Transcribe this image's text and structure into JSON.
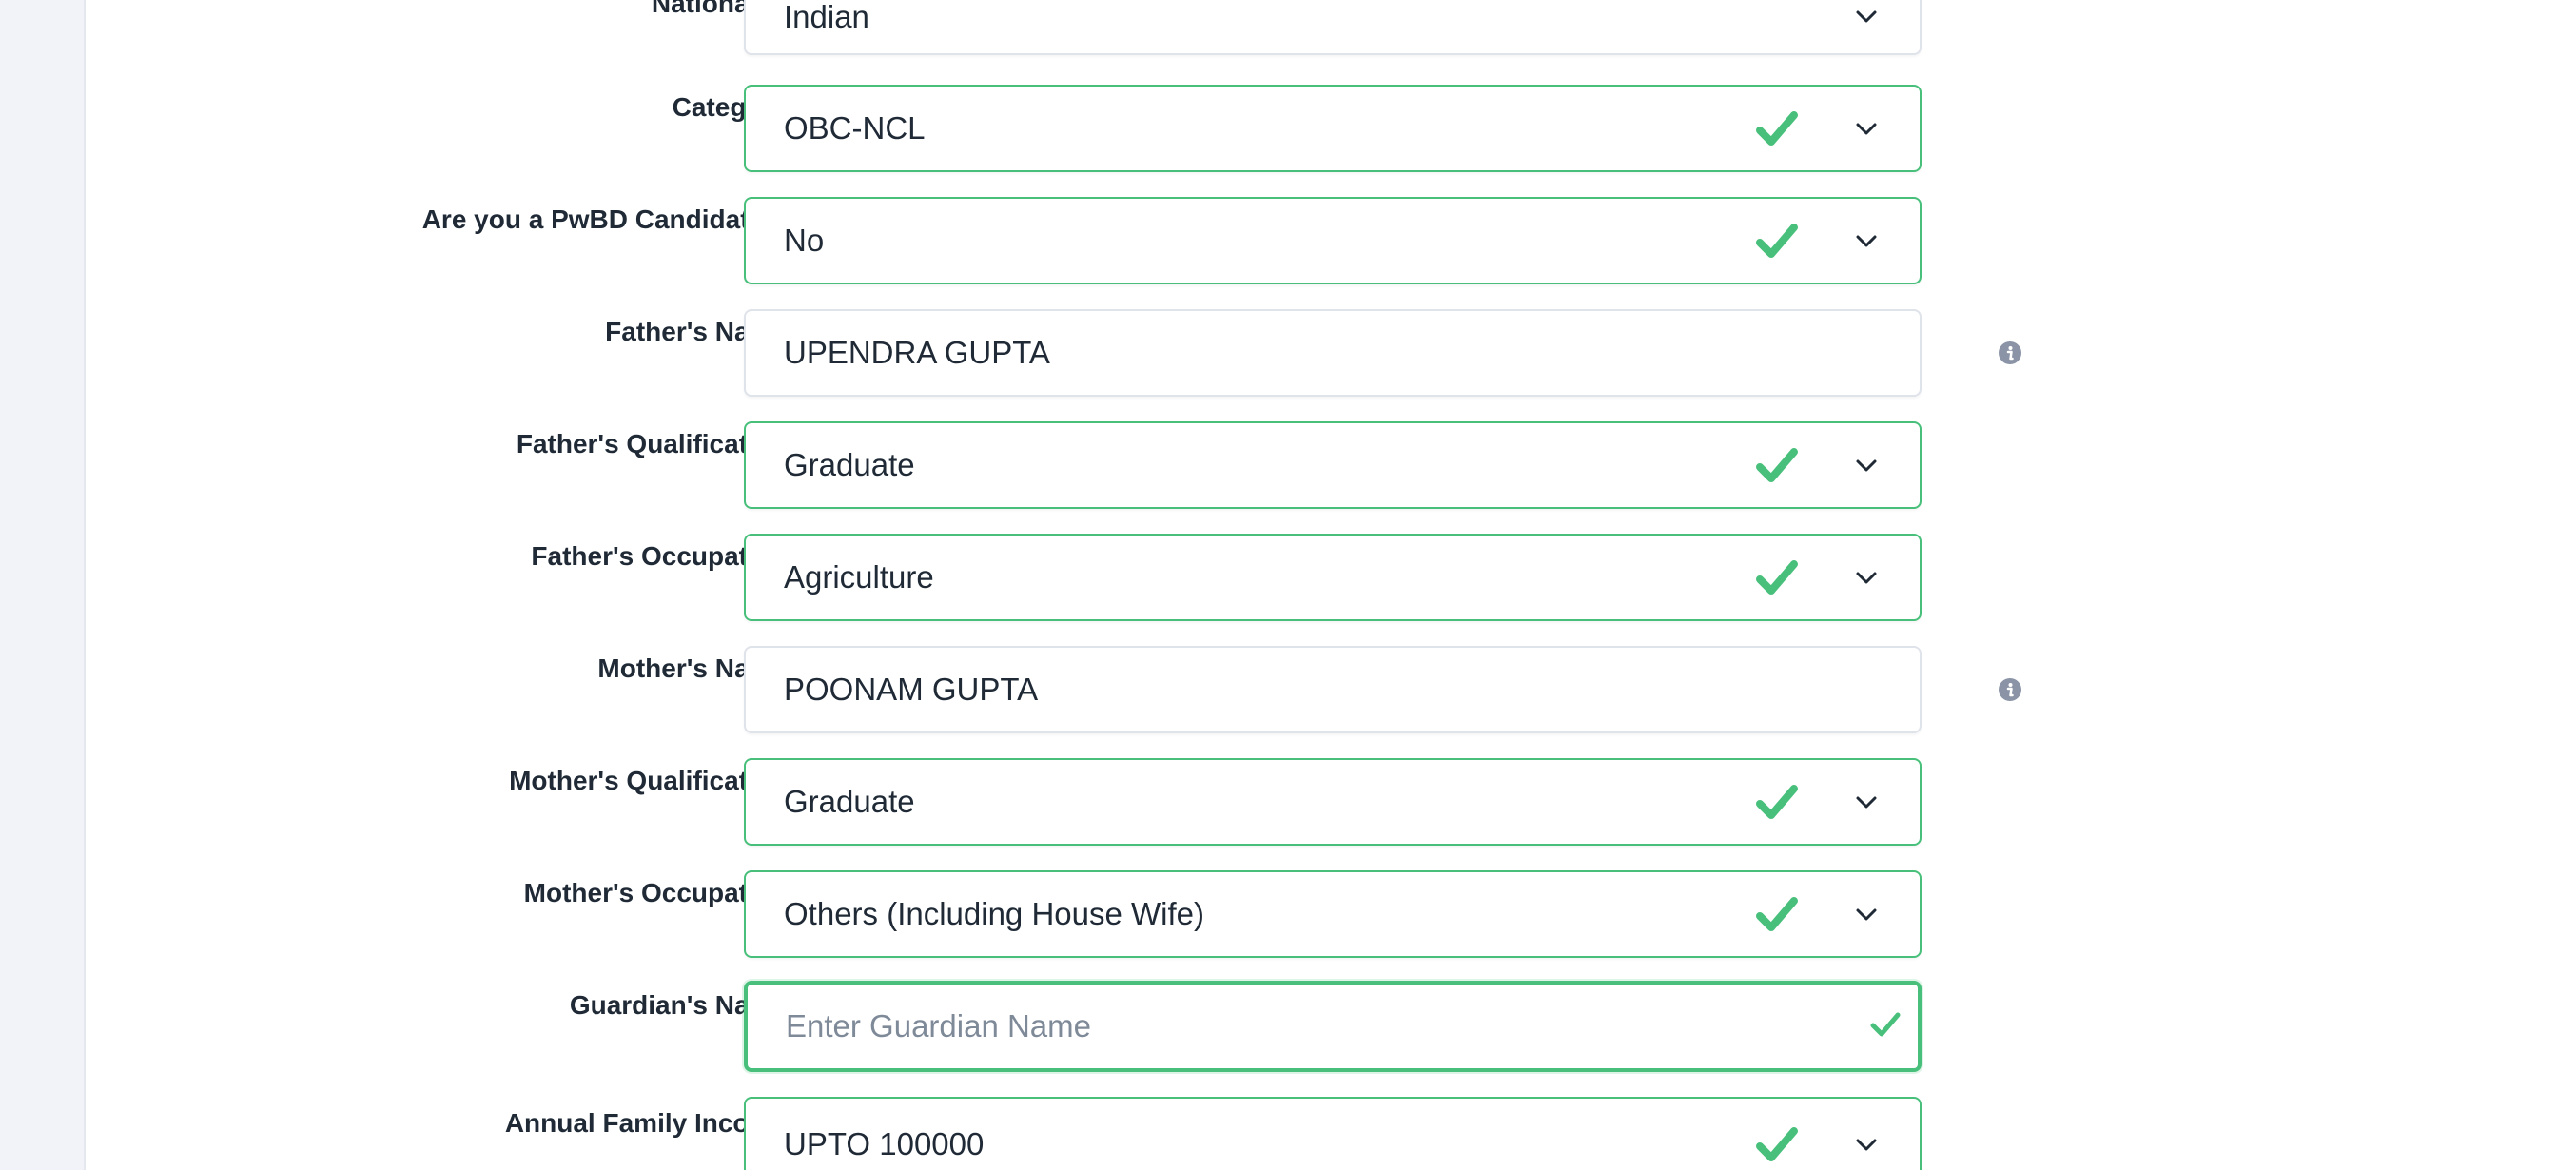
{
  "form": {
    "fields": [
      {
        "label": "Nationality",
        "value": "Indian"
      },
      {
        "label": "Category",
        "value": "OBC-NCL"
      },
      {
        "label": "Are you a PwBD Candidate ?",
        "value": "No"
      },
      {
        "label": "Father's Name",
        "value": "UPENDRA GUPTA"
      },
      {
        "label": "Father's Qualification",
        "value": "Graduate"
      },
      {
        "label": "Father's Occupation",
        "value": "Agriculture"
      },
      {
        "label": "Mother's Name",
        "value": "POONAM GUPTA"
      },
      {
        "label": "Mother's Qualification",
        "value": "Graduate"
      },
      {
        "label": "Mother's Occupation",
        "value": "Others (Including House Wife)"
      },
      {
        "label": "Guardian's Name",
        "placeholder": "Enter Guardian Name"
      },
      {
        "label": "Annual Family Income",
        "value": "UPTO 100000"
      }
    ]
  },
  "icons": {
    "check": "check-icon",
    "chevron": "chevron-down-icon",
    "info": "info-icon"
  },
  "colors": {
    "valid_border": "#48c07b",
    "check": "#48c07b",
    "text": "#1f2a36",
    "placeholder": "#7f8a99",
    "info": "#8a94a6",
    "rail": "#f2f3f8"
  }
}
